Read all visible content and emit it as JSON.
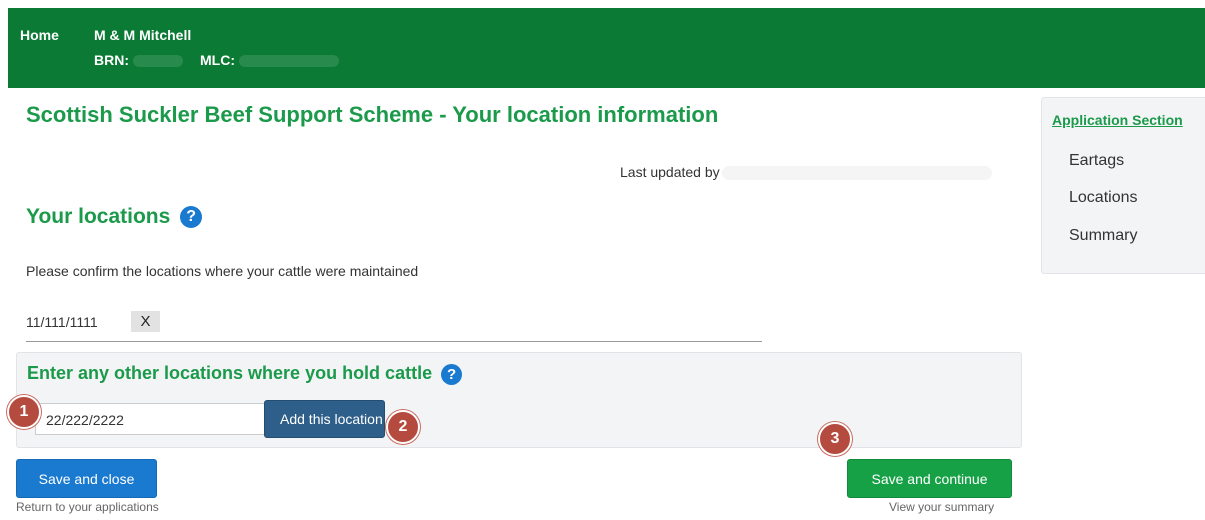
{
  "header": {
    "home_label": "Home",
    "farm_name": "M & M Mitchell",
    "brn_label": "BRN:",
    "mlc_label": "MLC:"
  },
  "page": {
    "title": "Scottish Suckler Beef Support Scheme - Your location information",
    "last_updated_label": "Last updated by"
  },
  "locations": {
    "heading": "Your locations",
    "help_glyph": "?",
    "instruction": "Please confirm the locations where your cattle were maintained",
    "items": [
      {
        "code": "11/111/1111",
        "remove_label": "X"
      }
    ]
  },
  "other_locations": {
    "heading": "Enter any other locations where you hold cattle",
    "help_glyph": "?",
    "input_value": "22/222/2222",
    "add_button_label": "Add this location"
  },
  "actions": {
    "save_close_label": "Save and close",
    "return_link": "Return to your applications",
    "save_continue_label": "Save and continue",
    "summary_link": "View your summary"
  },
  "sidebar": {
    "heading": "Application Section",
    "items": [
      {
        "label": "Eartags"
      },
      {
        "label": "Locations"
      },
      {
        "label": "Summary"
      }
    ]
  },
  "markers": [
    "1",
    "2",
    "3"
  ],
  "colors": {
    "header_bg": "#0b7a35",
    "title_green": "#1a9a4a",
    "primary_blue": "#1a7ad0",
    "add_button_blue": "#2e5f8a",
    "continue_green": "#17a146",
    "marker_red": "#b54a3e"
  }
}
